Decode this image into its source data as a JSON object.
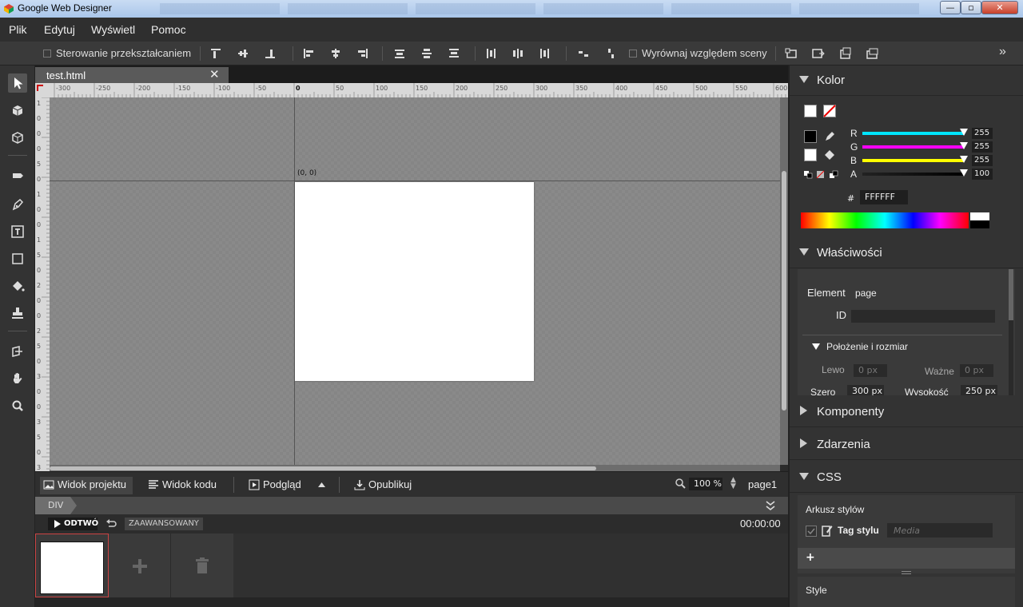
{
  "window": {
    "title": "Google Web Designer",
    "min_label": "—",
    "max_label": "▫",
    "close_label": "✕"
  },
  "menu": [
    "Plik",
    "Edytuj",
    "Wyświetl",
    "Pomoc"
  ],
  "toolbar": {
    "transform_label": "Sterowanie przekształcaniem",
    "align_scene_label": "Wyrównaj względem sceny",
    "overflow_label": "»"
  },
  "document": {
    "tab_name": "test.html",
    "tab_close": "✕",
    "origin_label": "(0, 0)"
  },
  "ruler": {
    "top_labels": [
      "-300",
      "-250",
      "-200",
      "-150",
      "-100",
      "-50",
      "0",
      "50",
      "100",
      "150",
      "200",
      "250",
      "300",
      "350",
      "400",
      "450",
      "500",
      "550",
      "600"
    ],
    "left_labels": [
      "1",
      "0",
      "0",
      "0",
      "5",
      "0",
      "1",
      "0",
      "0",
      "1",
      "5",
      "0",
      "2",
      "0",
      "0",
      "2",
      "5",
      "0",
      "3",
      "0",
      "0",
      "3",
      "5",
      "0",
      "3"
    ]
  },
  "viewbar": {
    "design_view": "Widok projektu",
    "code_view": "Widok kodu",
    "preview": "Podgląd",
    "publish": "Opublikuj",
    "zoom": "100 %",
    "page": "page1"
  },
  "timeline": {
    "breadcrumb": "DIV",
    "play": "ODTWÓ",
    "advanced": "ZAAWANSOWANY",
    "time": "00:00:00"
  },
  "panels": {
    "color": {
      "title": "Kolor",
      "channels": [
        {
          "name": "R",
          "value": "255",
          "color": "#00e5ff"
        },
        {
          "name": "G",
          "value": "255",
          "color": "#ff00ff"
        },
        {
          "name": "B",
          "value": "255",
          "color": "#ffff00"
        },
        {
          "name": "A",
          "value": "100",
          "color": "#000000"
        }
      ],
      "hex_label": "#",
      "hex": "FFFFFF"
    },
    "properties": {
      "title": "Właściwości",
      "element_label": "Element",
      "element_value": "page",
      "id_label": "ID",
      "position_section": "Położenie i rozmiar",
      "left_label": "Lewo",
      "left_value": "0 px",
      "important_label": "Ważne",
      "important_value": "0 px",
      "width_label": "Szero",
      "width_value": "300 px",
      "height_label": "Wysokość",
      "height_value": "250 px"
    },
    "components": {
      "title": "Komponenty"
    },
    "events": {
      "title": "Zdarzenia"
    },
    "css": {
      "title": "CSS",
      "stylesheet_label": "Arkusz stylów",
      "style_tag_label": "Tag stylu",
      "media_placeholder": "Media",
      "add_label": "+",
      "style_label": "Style"
    }
  }
}
